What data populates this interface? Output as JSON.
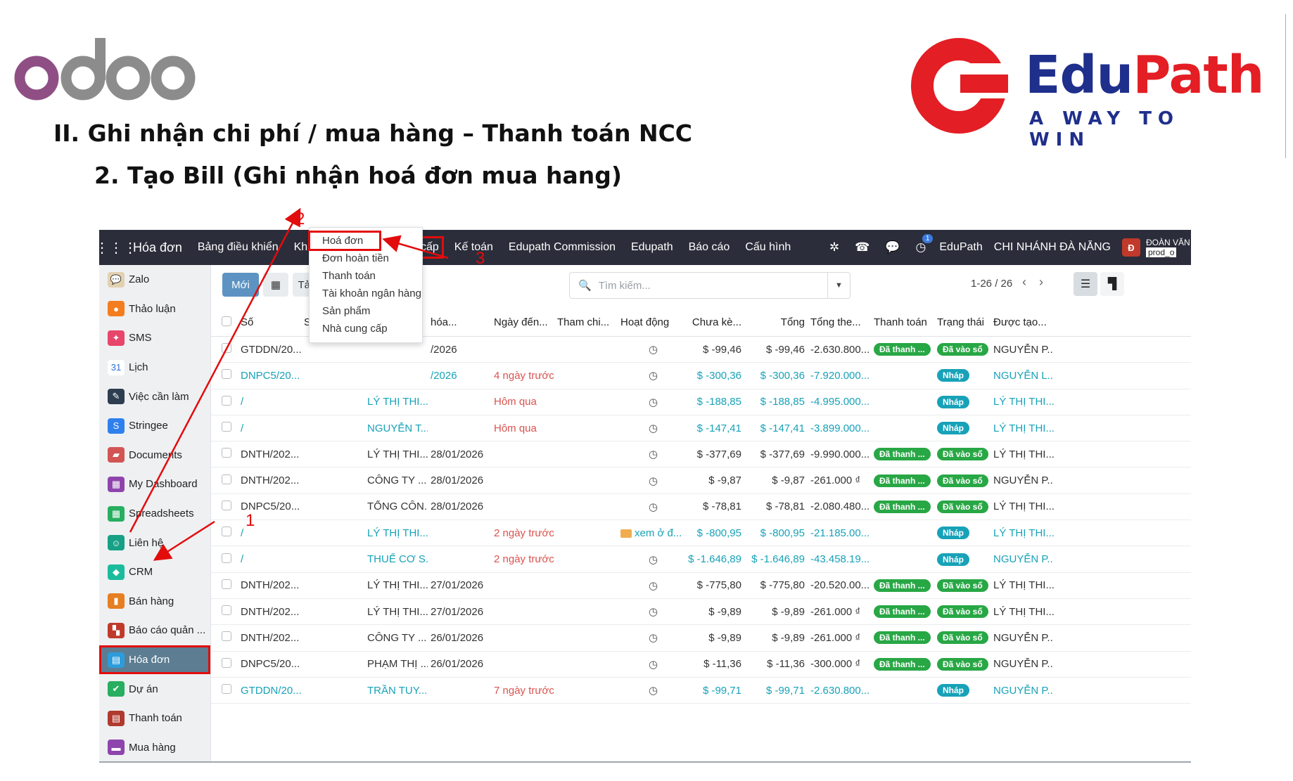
{
  "slide": {
    "heading_1": "II. Ghi nhận chi phí / mua hàng – Thanh toán NCC",
    "heading_2": "2. Tạo Bill (Ghi nhận hoá đơn mua hang)",
    "odoo_logo_text": "odoo",
    "edupath_brand_a": "Edu",
    "edupath_brand_b": "Path",
    "edupath_tagline": "A WAY TO WIN"
  },
  "topbar": {
    "app_title": "Hóa đơn",
    "menus": [
      "Bảng điều khiển",
      "Khách hàng",
      "Nhà cung cấp",
      "Kế toán",
      "Edupath Commission",
      "Edupath",
      "Báo cáo",
      "Cấu hình"
    ],
    "activity_count": "1",
    "company": "EduPath",
    "branch": "CHI NHÁNH ĐÀ NẴNG",
    "avatar_letter": "Đ",
    "user_name": "ĐOÀN VĂN",
    "user_db": "prod_o"
  },
  "sidebar": {
    "items": [
      {
        "label": "Zalo",
        "color": "#e2d1b0",
        "glyph": "💬"
      },
      {
        "label": "Thảo luận",
        "color": "#f47d20",
        "glyph": "●"
      },
      {
        "label": "SMS",
        "color": "#e8456b",
        "glyph": "✦"
      },
      {
        "label": "Lịch",
        "color": "#ffffff",
        "glyph": "31"
      },
      {
        "label": "Việc cần làm",
        "color": "#2c3e50",
        "glyph": "✎"
      },
      {
        "label": "Stringee",
        "color": "#2f80ed",
        "glyph": "S"
      },
      {
        "label": "Documents",
        "color": "#d35454",
        "glyph": "▰"
      },
      {
        "label": "My Dashboard",
        "color": "#8e44ad",
        "glyph": "▦"
      },
      {
        "label": "Spreadsheets",
        "color": "#27ae60",
        "glyph": "▦"
      },
      {
        "label": "Liên hệ",
        "color": "#16a085",
        "glyph": "☺"
      },
      {
        "label": "CRM",
        "color": "#1abc9c",
        "glyph": "◆"
      },
      {
        "label": "Bán hàng",
        "color": "#e67e22",
        "glyph": "▮"
      },
      {
        "label": "Báo cáo quản ...",
        "color": "#c0392b",
        "glyph": "▚"
      },
      {
        "label": "Hóa đơn",
        "color": "#2d9cdb",
        "glyph": "▤"
      },
      {
        "label": "Dự án",
        "color": "#27ae60",
        "glyph": "✔"
      },
      {
        "label": "Thanh toán",
        "color": "#b03a2e",
        "glyph": "▤"
      },
      {
        "label": "Mua hàng",
        "color": "#8e44ad",
        "glyph": "▬"
      }
    ]
  },
  "control": {
    "new_label": "Mới",
    "upload_label": "Tải lên",
    "breadcrumb": "Ho",
    "search_placeholder": "Tìm kiếm...",
    "pager": "1-26 / 26"
  },
  "dropdown": {
    "items": [
      "Hoá đơn",
      "Đơn hoàn tiền",
      "Thanh toán",
      "Tài khoản ngân hàng",
      "Sản phẩm",
      "Nhà cung cấp"
    ]
  },
  "table": {
    "headers": [
      "Số",
      "Số hoá đ",
      "",
      "hóa...",
      "Ngày đến...",
      "Tham chi...",
      "Hoạt động",
      "Chưa kè...",
      "Tổng",
      "Tổng the...",
      "Thanh toán",
      "Trạng thái",
      "Được tạo..."
    ],
    "rows": [
      {
        "so": "GTDDN/20...",
        "ncc": "",
        "hd": "/2026",
        "nd": "",
        "ck": "$ -99,46",
        "tong": "$ -99,46",
        "tt": "-2.630.800...",
        "ttoan": "Đã thanh ...",
        "tthai": "Đã vào sổ",
        "dt": "NGUYỄN P...",
        "draft": false,
        "nd_red": false
      },
      {
        "so": "DNPC5/20...",
        "ncc": "",
        "hd": "/2026",
        "nd": "4 ngày trước",
        "ck": "$ -300,36",
        "tong": "$ -300,36",
        "tt": "-7.920.000...",
        "ttoan": "",
        "tthai": "Nháp",
        "dt": "NGUYỄN L...",
        "draft": true,
        "nd_red": true
      },
      {
        "so": "/",
        "ncc": "LÝ THỊ THI...",
        "hd": "",
        "nd": "Hôm qua",
        "ck": "$ -188,85",
        "tong": "$ -188,85",
        "tt": "-4.995.000...",
        "ttoan": "",
        "tthai": "Nháp",
        "dt": "LÝ THỊ THI...",
        "draft": true,
        "nd_red": true
      },
      {
        "so": "/",
        "ncc": "NGUYỄN T...",
        "hd": "",
        "nd": "Hôm qua",
        "ck": "$ -147,41",
        "tong": "$ -147,41",
        "tt": "-3.899.000...",
        "ttoan": "",
        "tthai": "Nháp",
        "dt": "LÝ THỊ THI...",
        "draft": true,
        "nd_red": true
      },
      {
        "so": "DNTH/202...",
        "ncc": "LÝ THỊ THI...",
        "hd": "28/01/2026",
        "nd": "",
        "ck": "$ -377,69",
        "tong": "$ -377,69",
        "tt": "-9.990.000...",
        "ttoan": "Đã thanh ...",
        "tthai": "Đã vào sổ",
        "dt": "LÝ THỊ THI...",
        "draft": false,
        "nd_red": false
      },
      {
        "so": "DNTH/202...",
        "ncc": "CÔNG TY ...",
        "hd": "28/01/2026",
        "nd": "",
        "ck": "$ -9,87",
        "tong": "$ -9,87",
        "tt": "-261.000 ₫",
        "ttoan": "Đã thanh ...",
        "tthai": "Đã vào sổ",
        "dt": "NGUYỄN P...",
        "draft": false,
        "nd_red": false
      },
      {
        "so": "DNPC5/20...",
        "ncc": "TỔNG CÔN...",
        "hd": "28/01/2026",
        "nd": "",
        "ck": "$ -78,81",
        "tong": "$ -78,81",
        "tt": "-2.080.480...",
        "ttoan": "Đã thanh ...",
        "tthai": "Đã vào sổ",
        "dt": "LÝ THỊ THI...",
        "draft": false,
        "nd_red": false
      },
      {
        "so": "/",
        "ncc": "LÝ THỊ THI...",
        "hd": "",
        "nd": "2 ngày trước",
        "ck": "$ -800,95",
        "tong": "$ -800,95",
        "tt": "-21.185.00...",
        "ttoan": "",
        "tthai": "Nháp",
        "dt": "LÝ THỊ THI...",
        "draft": true,
        "nd_red": true,
        "activity_text": "xem ở đ..."
      },
      {
        "so": "/",
        "ncc": "THUẾ CƠ S...",
        "hd": "",
        "nd": "2 ngày trước",
        "ck": "$ -1.646,89",
        "tong": "$ -1.646,89",
        "tt": "-43.458.19...",
        "ttoan": "",
        "tthai": "Nháp",
        "dt": "NGUYỄN P...",
        "draft": true,
        "nd_red": true
      },
      {
        "so": "DNTH/202...",
        "ncc": "LÝ THỊ THI...",
        "hd": "27/01/2026",
        "nd": "",
        "ck": "$ -775,80",
        "tong": "$ -775,80",
        "tt": "-20.520.00...",
        "ttoan": "Đã thanh ...",
        "tthai": "Đã vào sổ",
        "dt": "LÝ THỊ THI...",
        "draft": false,
        "nd_red": false
      },
      {
        "so": "DNTH/202...",
        "ncc": "LÝ THỊ THI...",
        "hd": "27/01/2026",
        "nd": "",
        "ck": "$ -9,89",
        "tong": "$ -9,89",
        "tt": "-261.000 ₫",
        "ttoan": "Đã thanh ...",
        "tthai": "Đã vào sổ",
        "dt": "LÝ THỊ THI...",
        "draft": false,
        "nd_red": false
      },
      {
        "so": "DNTH/202...",
        "ncc": "CÔNG TY ...",
        "hd": "26/01/2026",
        "nd": "",
        "ck": "$ -9,89",
        "tong": "$ -9,89",
        "tt": "-261.000 ₫",
        "ttoan": "Đã thanh ...",
        "tthai": "Đã vào sổ",
        "dt": "NGUYỄN P...",
        "draft": false,
        "nd_red": false
      },
      {
        "so": "DNPC5/20...",
        "ncc": "PHẠM THỊ ...",
        "hd": "26/01/2026",
        "nd": "",
        "ck": "$ -11,36",
        "tong": "$ -11,36",
        "tt": "-300.000 ₫",
        "ttoan": "Đã thanh ...",
        "tthai": "Đã vào sổ",
        "dt": "NGUYỄN P...",
        "draft": false,
        "nd_red": false
      },
      {
        "so": "GTDDN/20...",
        "ncc": "TRẦN TUY...",
        "hd": "",
        "nd": "7 ngày trước",
        "ck": "$ -99,71",
        "tong": "$ -99,71",
        "tt": "-2.630.800...",
        "ttoan": "",
        "tthai": "Nháp",
        "dt": "NGUYỄN P...",
        "draft": true,
        "nd_red": true
      }
    ]
  },
  "annotations": {
    "step1": "1",
    "step2": "2",
    "step3": "3"
  },
  "colors": {
    "accent_red": "#e30c0c",
    "topbar": "#2b2d3a",
    "primary": "#5c93c2",
    "paid_green": "#28a745",
    "draft_teal": "#17a2b8"
  }
}
